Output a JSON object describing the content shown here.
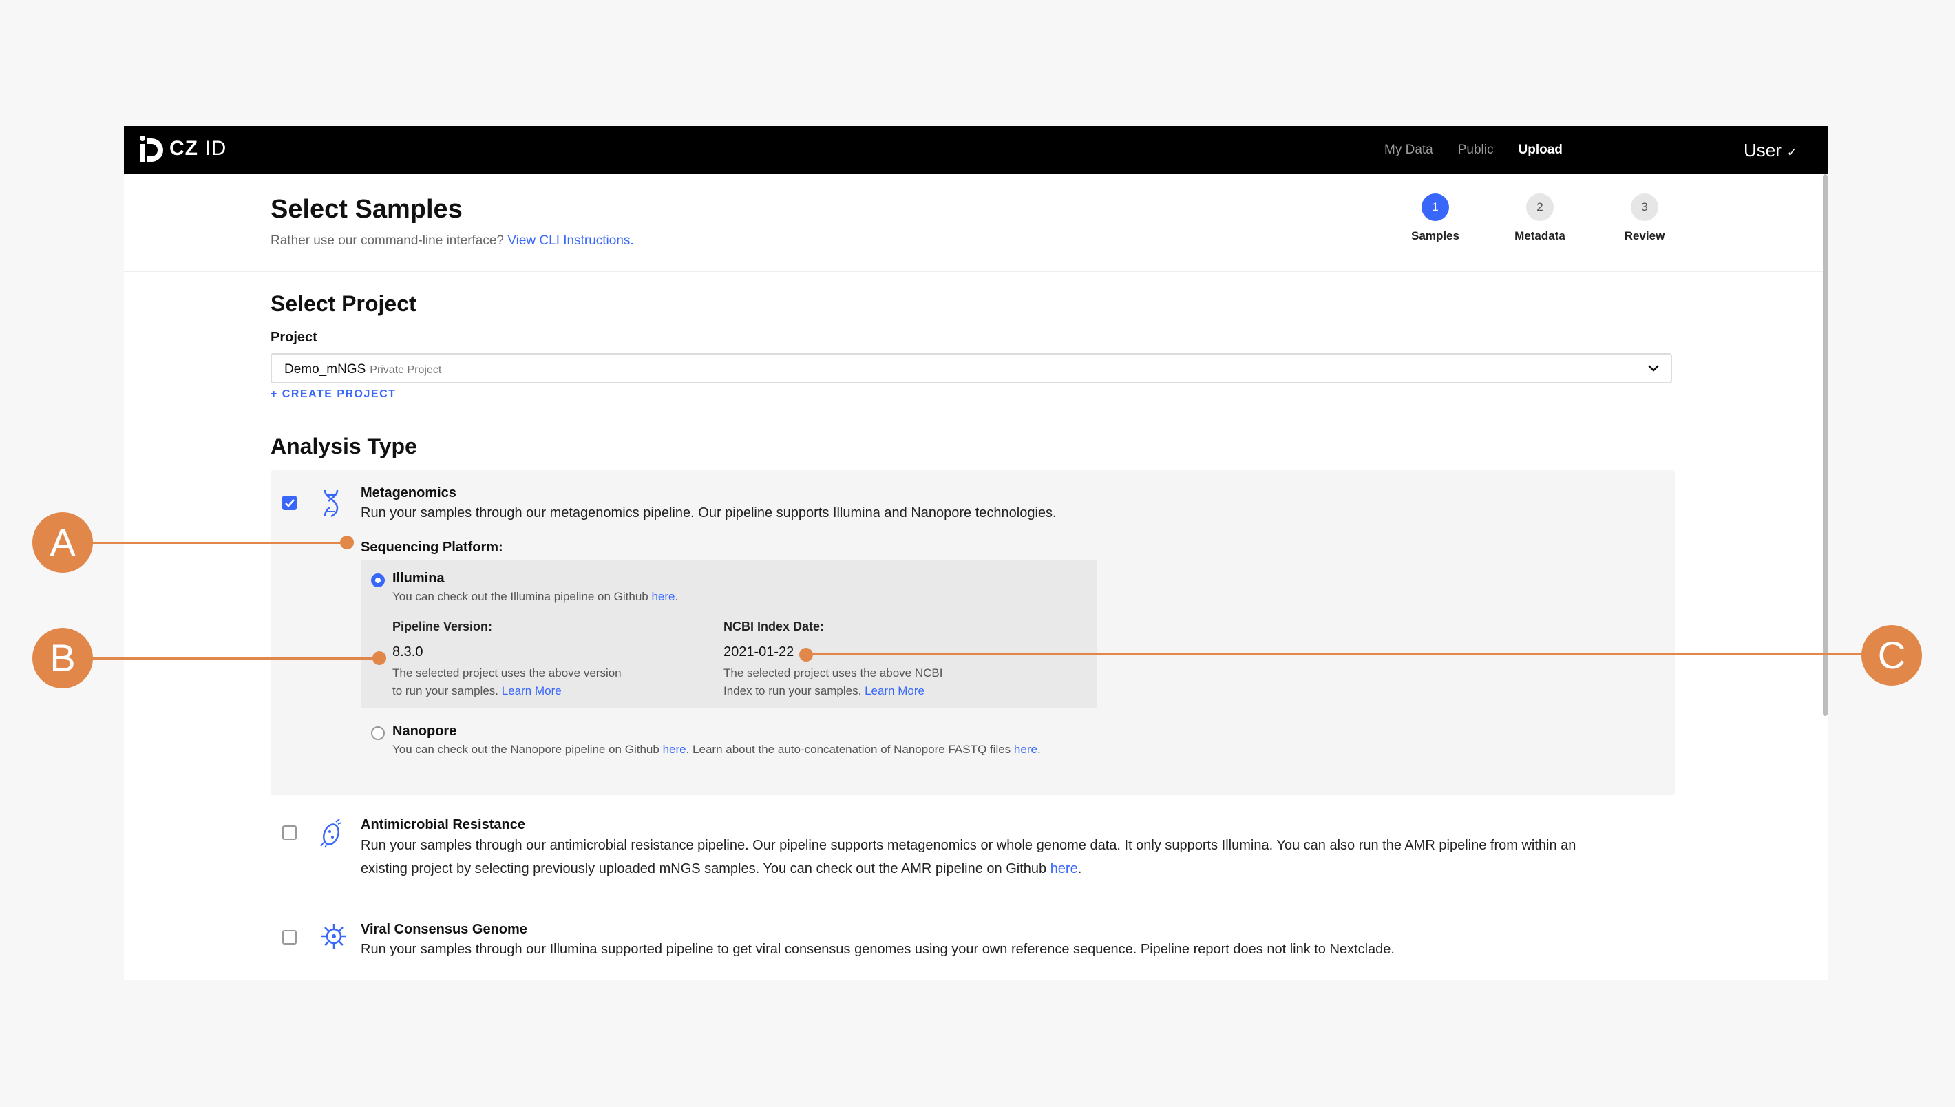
{
  "nav": {
    "logo_bold": "CZ",
    "logo_light": "ID",
    "links": [
      "My Data",
      "Public",
      "Upload"
    ],
    "user": "User",
    "user_chevron": "✓"
  },
  "header": {
    "title": "Select Samples",
    "cli_prefix": "Rather use our command-line interface?",
    "cli_link": "View CLI Instructions.",
    "steps": [
      {
        "number": "1",
        "label": "Samples",
        "active": true
      },
      {
        "number": "2",
        "label": "Metadata",
        "active": false
      },
      {
        "number": "3",
        "label": "Review",
        "active": false
      }
    ]
  },
  "project": {
    "section_title": "Select Project",
    "field_label": "Project",
    "selected_name": "Demo_mNGS",
    "selected_sub": "Private Project",
    "create_label": "+ CREATE PROJECT"
  },
  "analysis": {
    "section_title": "Analysis Type",
    "metagenomics": {
      "title": "Metagenomics",
      "desc": "Run your samples through our metagenomics pipeline. Our pipeline supports Illumina and Nanopore technologies.",
      "checked": true,
      "sequencing_label": "Sequencing Platform:",
      "illumina": {
        "title": "Illumina",
        "desc_prefix": "You can check out the Illumina pipeline on Github",
        "desc_link": "here",
        "desc_suffix": ".",
        "pipeline_label": "Pipeline Version:",
        "pipeline_value": "8.3.0",
        "pipeline_note_1": "The selected project uses the above version",
        "pipeline_note_2": "to run your samples.",
        "pipeline_note_link": "Learn More",
        "ncbi_label": "NCBI Index Date:",
        "ncbi_value": "2021-01-22",
        "ncbi_note_1": "The selected project uses the above NCBI",
        "ncbi_note_2": "Index to run your samples.",
        "ncbi_note_link": "Learn More"
      },
      "nanopore": {
        "title": "Nanopore",
        "desc_prefix": "You can check out the Nanopore pipeline on Github",
        "desc_link_1": "here",
        "desc_mid": ". Learn about the auto-concatenation of Nanopore FASTQ files",
        "desc_link_2": "here",
        "desc_suffix": "."
      }
    },
    "amr": {
      "title": "Antimicrobial Resistance",
      "desc_line_1": "Run your samples through our antimicrobial resistance pipeline. Our pipeline supports metagenomics or whole genome data. It only supports Illumina. You can also run the AMR pipeline from within an",
      "desc_line_2": "existing project by selecting previously uploaded mNGS samples. You can check out the AMR pipeline on Github",
      "desc_link": "here",
      "desc_suffix": ".",
      "checked": false
    },
    "viral": {
      "title": "Viral Consensus Genome",
      "desc": "Run your samples through our Illumina supported pipeline to get viral consensus genomes using your own reference sequence. Pipeline report does not link to Nextclade.",
      "checked": false
    }
  },
  "annotations": {
    "a": "A",
    "b": "B",
    "c": "C",
    "color": "#e2874a"
  },
  "colors": {
    "accent": "#3867fa",
    "nav_bg": "#000000"
  }
}
